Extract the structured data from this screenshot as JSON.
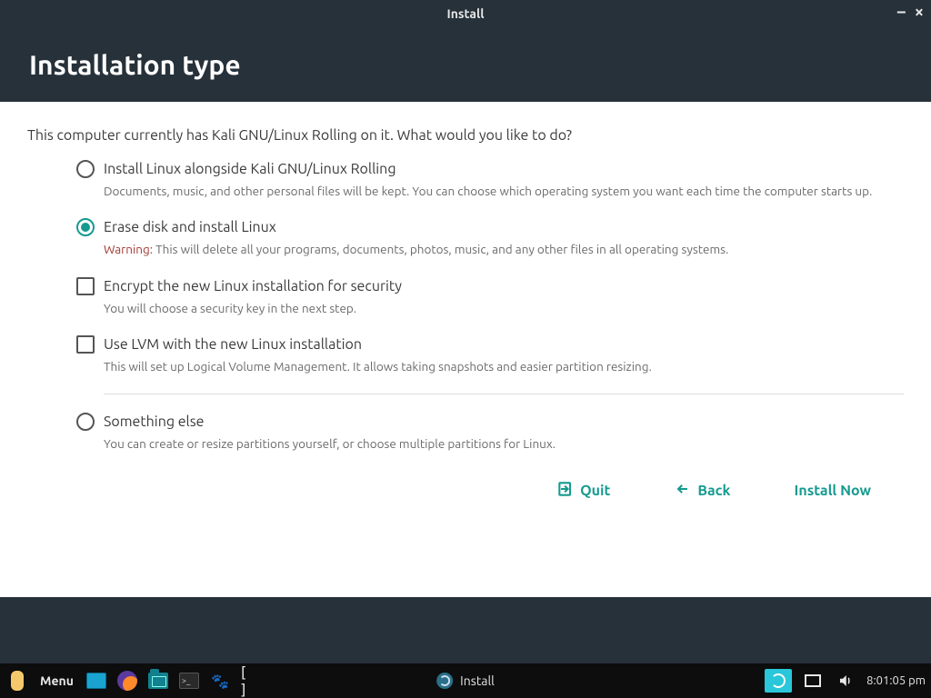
{
  "window": {
    "title": "Install"
  },
  "header": {
    "title": "Installation type"
  },
  "intro": "This computer currently has Kali GNU/Linux Rolling on it. What would you like to do?",
  "options": {
    "alongside": {
      "label": "Install Linux alongside Kali GNU/Linux Rolling",
      "desc": "Documents, music, and other personal files will be kept. You can choose which operating system you want each time the computer starts up."
    },
    "erase": {
      "label": "Erase disk and install Linux",
      "warning_prefix": "Warning:",
      "desc": " This will delete all your programs, documents, photos, music, and any other files in all operating systems."
    },
    "encrypt": {
      "label": "Encrypt the new Linux installation for security",
      "desc": "You will choose a security key in the next step."
    },
    "lvm": {
      "label": "Use LVM with the new Linux installation",
      "desc": "This will set up Logical Volume Management. It allows taking snapshots and easier partition resizing."
    },
    "something_else": {
      "label": "Something else",
      "desc": "You can create or resize partitions yourself, or choose multiple partitions for Linux."
    }
  },
  "buttons": {
    "quit": "Quit",
    "back": "Back",
    "install": "Install Now"
  },
  "taskbar": {
    "menu": "Menu",
    "brackets": "[ ]",
    "center_app": "Install",
    "time": "8:01:05 pm"
  }
}
